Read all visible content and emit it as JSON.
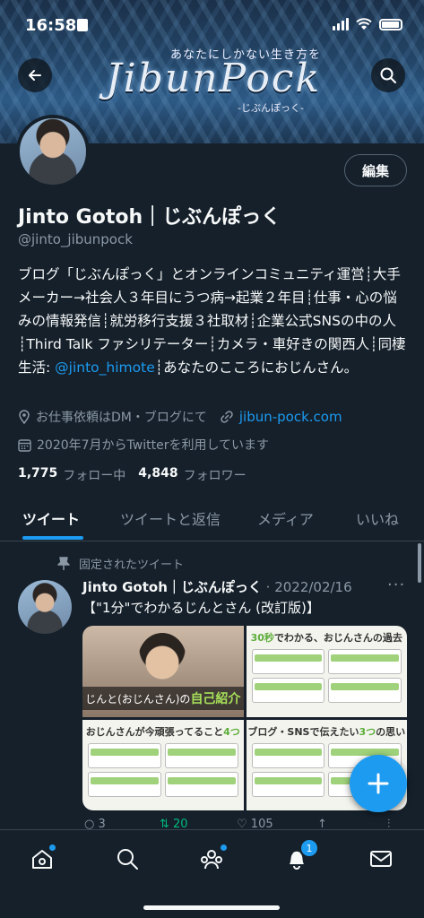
{
  "status_bar": {
    "time": "16:58"
  },
  "header": {
    "banner_subtitle": "あなたにしかない生き方を",
    "banner_logo": "JibunPock",
    "banner_kana": "-じぶんぽっく-"
  },
  "profile": {
    "edit_label": "編集",
    "display_name": "Jinto Gotoh｜じぶんぽっく",
    "handle": "@jinto_jibunpock",
    "bio_before_mention": "ブログ「じぶんぽっく」とオンラインコミュニティ運営┊大手メーカー→社会人３年目にうつ病→起業２年目┊仕事・心の悩みの情報発信┊就労移行支援３社取材┊企業公式SNSの中の人┊Third Talk ファシリテーター┊カメラ・車好きの関西人┊同棲生活: ",
    "bio_mention": "@jinto_himote",
    "bio_after_mention": "┊あなたのこころにおじんさん。",
    "location": "お仕事依頼はDM・ブログにて",
    "website": "jibun-pock.com",
    "joined": "2020年7月からTwitterを利用しています",
    "following_count": "1,775",
    "following_label": "フォロー中",
    "followers_count": "4,848",
    "followers_label": "フォロワー"
  },
  "tabs": [
    "ツイート",
    "ツイートと返信",
    "メディア",
    "いいね"
  ],
  "tweet": {
    "pinned_label": "固定されたツイート",
    "author": "Jinto Gotoh｜じぶんぽっく",
    "date": "· 2022/02/16",
    "text": "【\"1分\"でわかるじんとさん (改訂版)】",
    "media": {
      "cell1_caption_prefix": "じんと(おじんさん)の",
      "cell1_caption_em": "自己紹介",
      "cell2_title_prefix": "30秒",
      "cell2_title_rest": "でわかる、おじんさんの過去",
      "cell3_title_prefix": "おじんさんが今頑張ってること",
      "cell3_title_em": "4つ",
      "cell4_title_prefix": "ブログ・SNSで伝えたい",
      "cell4_title_em": "3つ",
      "cell4_title_rest": "の思い"
    },
    "actions": {
      "replies": "3",
      "retweets": "20",
      "likes": "105"
    }
  },
  "bottom_nav": {
    "notifications_badge": "1"
  },
  "colors": {
    "accent": "#1d9bf0",
    "background": "#15202b",
    "muted": "#8b98a5"
  }
}
